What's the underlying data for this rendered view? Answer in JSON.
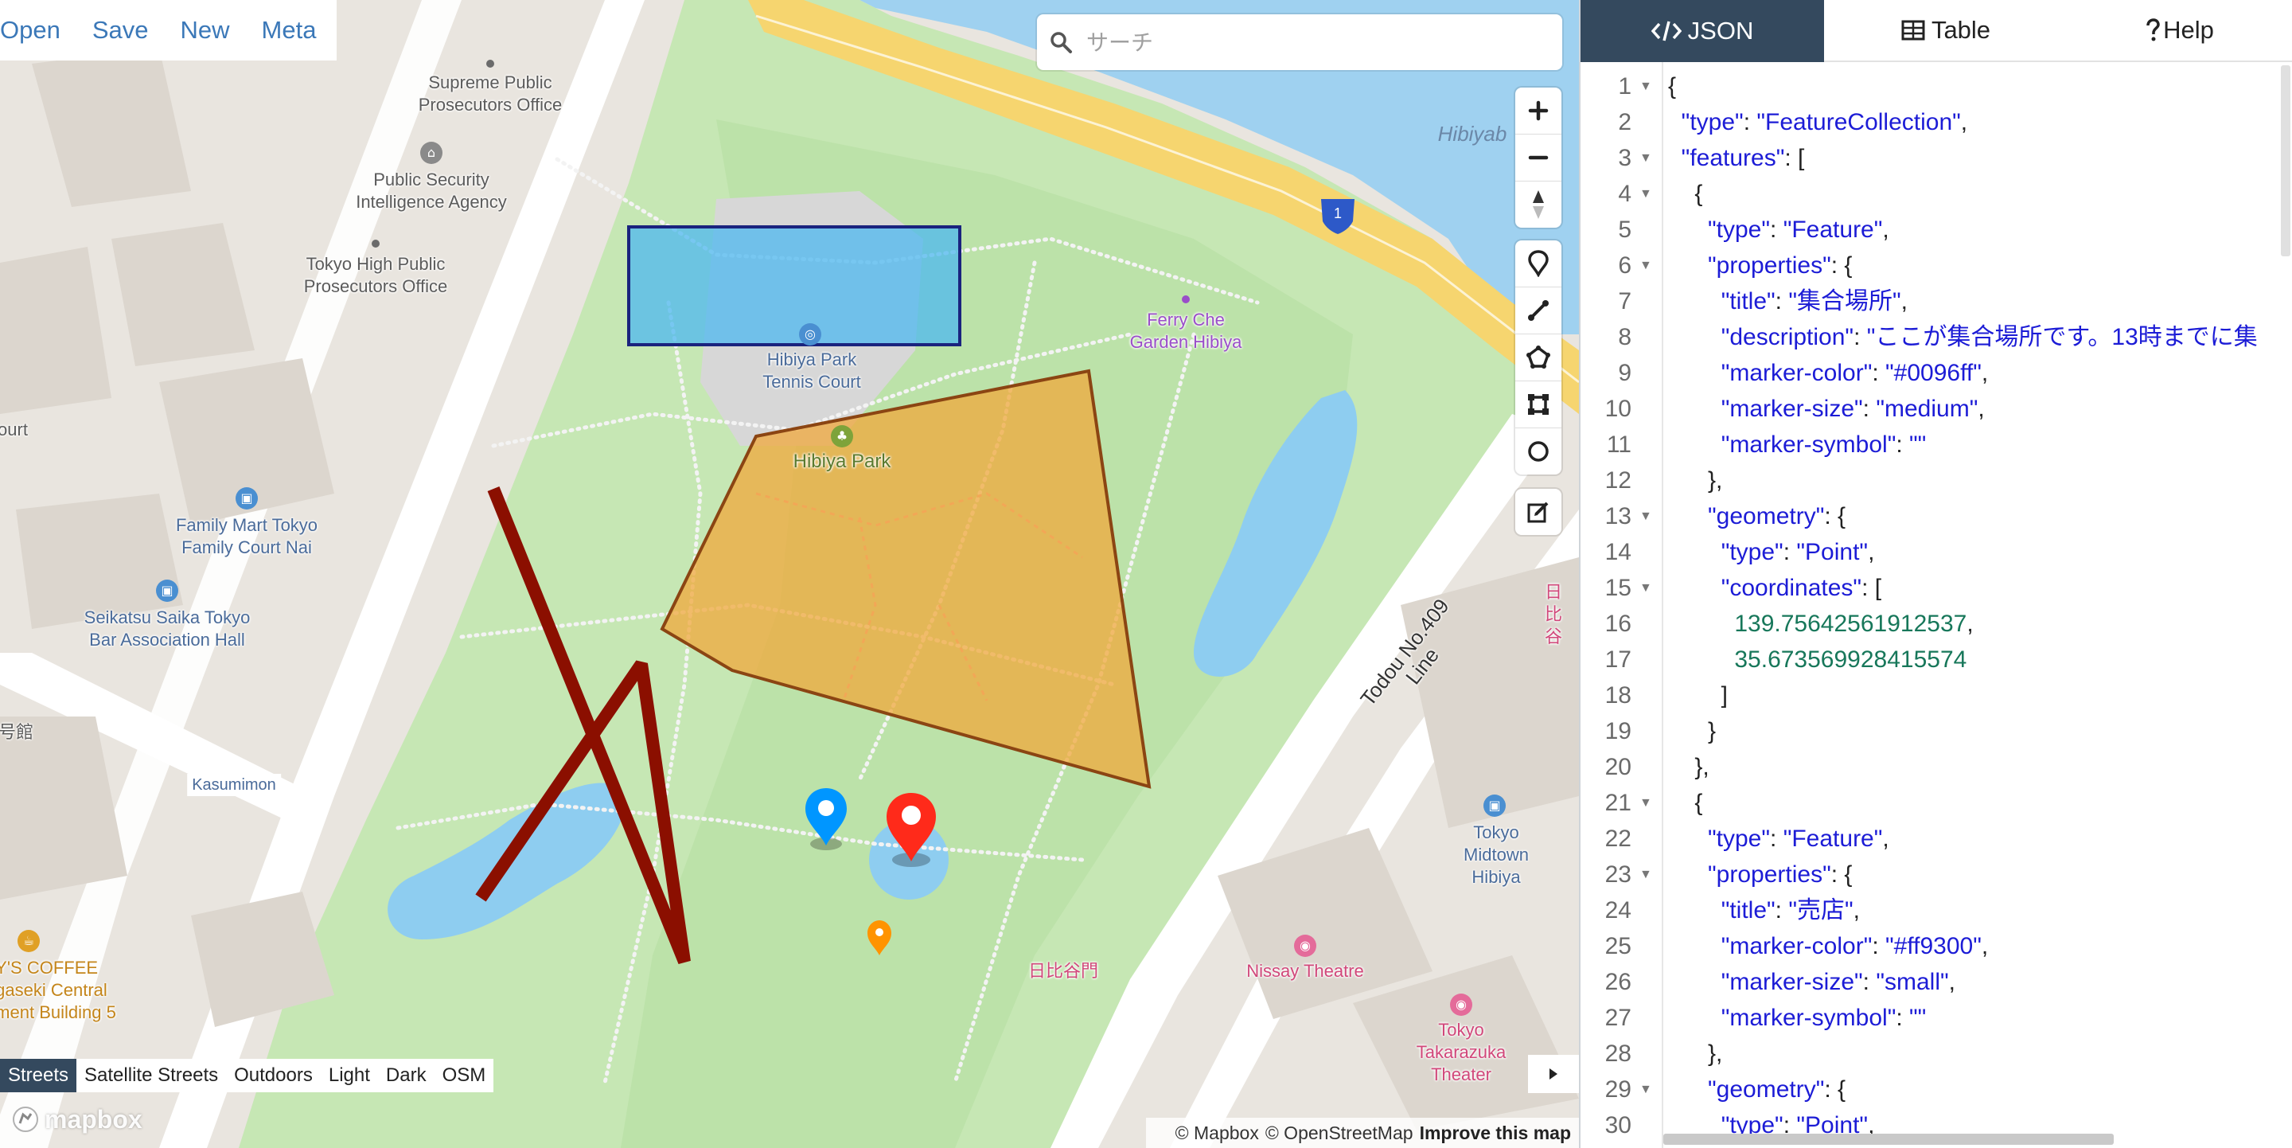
{
  "file_menu": {
    "items": [
      "Open",
      "Save",
      "New",
      "Meta"
    ]
  },
  "search": {
    "placeholder": "サーチ"
  },
  "map": {
    "labels": {
      "supreme_prosecutors": "Supreme Public\nProsecutors Office",
      "public_security": "Public Security\nIntelligence Agency",
      "tokyo_high": "Tokyo High Public\nProsecutors Office",
      "court": "ourt",
      "family_mart": "Family Mart Tokyo\nFamily Court Nai",
      "seikatsu": "Seikatsu Saika Tokyo\nBar Association Hall",
      "go_kan": "号館",
      "kasumimon": "Kasumimon",
      "coffee": "Y'S COFFEE\ngaseki Central\nment Building 5",
      "tennis_court": "Hibiya Park\nTennis Court",
      "hibiya_park": "Hibiya Park",
      "ferry_che": "Ferry Che\nGarden Hibiya",
      "hibiya_water": "Hibiyab",
      "todou_line": "Todou No.409 Line",
      "hibiya_jp": "日比谷",
      "hibiya_gate": "日比谷門",
      "midtown": "Tokyo Midtown Hibiya",
      "nissay": "Nissay Theatre",
      "takarazuka": "Tokyo Takarazuka\nTheater",
      "route_shield": "1"
    },
    "feature_colors": {
      "rectangle_fill": "#4db8f0",
      "rectangle_stroke": "#1a237e",
      "polygon_fill": "#f0a83c",
      "polygon_stroke": "#8b4513",
      "line_stroke": "#8b0f00",
      "marker_blue": "#0096ff",
      "marker_red": "#ff2a1a",
      "marker_orange": "#ff9300"
    }
  },
  "map_controls": {
    "zoom": [
      "zoom-in-icon",
      "zoom-out-icon",
      "compass-icon"
    ],
    "draw": [
      "marker-icon",
      "line-icon",
      "polygon-icon",
      "rectangle-icon",
      "circle-icon"
    ],
    "edit": [
      "edit-icon"
    ]
  },
  "style_switcher": {
    "options": [
      "Streets",
      "Satellite Streets",
      "Outdoors",
      "Light",
      "Dark",
      "OSM"
    ],
    "active": "Streets"
  },
  "mapbox_logo": "mapbox",
  "attribution": {
    "mapbox": "© Mapbox",
    "osm": "© OpenStreetMap",
    "improve": "Improve this map"
  },
  "tabs": {
    "json": "JSON",
    "table": "Table",
    "help": "Help",
    "active": "JSON"
  },
  "editor": {
    "lines": [
      {
        "n": "1",
        "fold": true,
        "code": [
          [
            "p",
            "{"
          ]
        ]
      },
      {
        "n": "2",
        "fold": false,
        "code": [
          [
            "p",
            "  "
          ],
          [
            "k",
            "\"type\""
          ],
          [
            "p",
            ": "
          ],
          [
            "s",
            "\"FeatureCollection\""
          ],
          [
            "p",
            ","
          ]
        ]
      },
      {
        "n": "3",
        "fold": true,
        "code": [
          [
            "p",
            "  "
          ],
          [
            "k",
            "\"features\""
          ],
          [
            "p",
            ": ["
          ]
        ]
      },
      {
        "n": "4",
        "fold": true,
        "code": [
          [
            "p",
            "    {"
          ]
        ]
      },
      {
        "n": "5",
        "fold": false,
        "code": [
          [
            "p",
            "      "
          ],
          [
            "k",
            "\"type\""
          ],
          [
            "p",
            ": "
          ],
          [
            "s",
            "\"Feature\""
          ],
          [
            "p",
            ","
          ]
        ]
      },
      {
        "n": "6",
        "fold": true,
        "code": [
          [
            "p",
            "      "
          ],
          [
            "k",
            "\"properties\""
          ],
          [
            "p",
            ": {"
          ]
        ]
      },
      {
        "n": "7",
        "fold": false,
        "code": [
          [
            "p",
            "        "
          ],
          [
            "k",
            "\"title\""
          ],
          [
            "p",
            ": "
          ],
          [
            "s",
            "\"集合場所\""
          ],
          [
            "p",
            ","
          ]
        ]
      },
      {
        "n": "8",
        "fold": false,
        "code": [
          [
            "p",
            "        "
          ],
          [
            "k",
            "\"description\""
          ],
          [
            "p",
            ": "
          ],
          [
            "s",
            "\"ここが集合場所です。13時までに集"
          ]
        ]
      },
      {
        "n": "9",
        "fold": false,
        "code": [
          [
            "p",
            "        "
          ],
          [
            "k",
            "\"marker-color\""
          ],
          [
            "p",
            ": "
          ],
          [
            "s",
            "\"#0096ff\""
          ],
          [
            "p",
            ","
          ]
        ]
      },
      {
        "n": "10",
        "fold": false,
        "code": [
          [
            "p",
            "        "
          ],
          [
            "k",
            "\"marker-size\""
          ],
          [
            "p",
            ": "
          ],
          [
            "s",
            "\"medium\""
          ],
          [
            "p",
            ","
          ]
        ]
      },
      {
        "n": "11",
        "fold": false,
        "code": [
          [
            "p",
            "        "
          ],
          [
            "k",
            "\"marker-symbol\""
          ],
          [
            "p",
            ": "
          ],
          [
            "s",
            "\"\""
          ]
        ]
      },
      {
        "n": "12",
        "fold": false,
        "code": [
          [
            "p",
            "      },"
          ]
        ]
      },
      {
        "n": "13",
        "fold": true,
        "code": [
          [
            "p",
            "      "
          ],
          [
            "k",
            "\"geometry\""
          ],
          [
            "p",
            ": {"
          ]
        ]
      },
      {
        "n": "14",
        "fold": false,
        "code": [
          [
            "p",
            "        "
          ],
          [
            "k",
            "\"type\""
          ],
          [
            "p",
            ": "
          ],
          [
            "s",
            "\"Point\""
          ],
          [
            "p",
            ","
          ]
        ]
      },
      {
        "n": "15",
        "fold": true,
        "code": [
          [
            "p",
            "        "
          ],
          [
            "k",
            "\"coordinates\""
          ],
          [
            "p",
            ": ["
          ]
        ]
      },
      {
        "n": "16",
        "fold": false,
        "code": [
          [
            "p",
            "          "
          ],
          [
            "n",
            "139.75642561912537"
          ],
          [
            "p",
            ","
          ]
        ]
      },
      {
        "n": "17",
        "fold": false,
        "code": [
          [
            "p",
            "          "
          ],
          [
            "n",
            "35.673569928415574"
          ]
        ]
      },
      {
        "n": "18",
        "fold": false,
        "code": [
          [
            "p",
            "        ]"
          ]
        ]
      },
      {
        "n": "19",
        "fold": false,
        "code": [
          [
            "p",
            "      }"
          ]
        ]
      },
      {
        "n": "20",
        "fold": false,
        "code": [
          [
            "p",
            "    },"
          ]
        ]
      },
      {
        "n": "21",
        "fold": true,
        "code": [
          [
            "p",
            "    {"
          ]
        ]
      },
      {
        "n": "22",
        "fold": false,
        "code": [
          [
            "p",
            "      "
          ],
          [
            "k",
            "\"type\""
          ],
          [
            "p",
            ": "
          ],
          [
            "s",
            "\"Feature\""
          ],
          [
            "p",
            ","
          ]
        ]
      },
      {
        "n": "23",
        "fold": true,
        "code": [
          [
            "p",
            "      "
          ],
          [
            "k",
            "\"properties\""
          ],
          [
            "p",
            ": {"
          ]
        ]
      },
      {
        "n": "24",
        "fold": false,
        "code": [
          [
            "p",
            "        "
          ],
          [
            "k",
            "\"title\""
          ],
          [
            "p",
            ": "
          ],
          [
            "s",
            "\"売店\""
          ],
          [
            "p",
            ","
          ]
        ]
      },
      {
        "n": "25",
        "fold": false,
        "code": [
          [
            "p",
            "        "
          ],
          [
            "k",
            "\"marker-color\""
          ],
          [
            "p",
            ": "
          ],
          [
            "s",
            "\"#ff9300\""
          ],
          [
            "p",
            ","
          ]
        ]
      },
      {
        "n": "26",
        "fold": false,
        "code": [
          [
            "p",
            "        "
          ],
          [
            "k",
            "\"marker-size\""
          ],
          [
            "p",
            ": "
          ],
          [
            "s",
            "\"small\""
          ],
          [
            "p",
            ","
          ]
        ]
      },
      {
        "n": "27",
        "fold": false,
        "code": [
          [
            "p",
            "        "
          ],
          [
            "k",
            "\"marker-symbol\""
          ],
          [
            "p",
            ": "
          ],
          [
            "s",
            "\"\""
          ]
        ]
      },
      {
        "n": "28",
        "fold": false,
        "code": [
          [
            "p",
            "      },"
          ]
        ]
      },
      {
        "n": "29",
        "fold": true,
        "code": [
          [
            "p",
            "      "
          ],
          [
            "k",
            "\"geometry\""
          ],
          [
            "p",
            ": {"
          ]
        ]
      },
      {
        "n": "30",
        "fold": false,
        "code": [
          [
            "p",
            "        "
          ],
          [
            "k",
            "\"type\""
          ],
          [
            "p",
            ": "
          ],
          [
            "s",
            "\"Point\""
          ],
          [
            "p",
            ","
          ]
        ]
      }
    ]
  }
}
